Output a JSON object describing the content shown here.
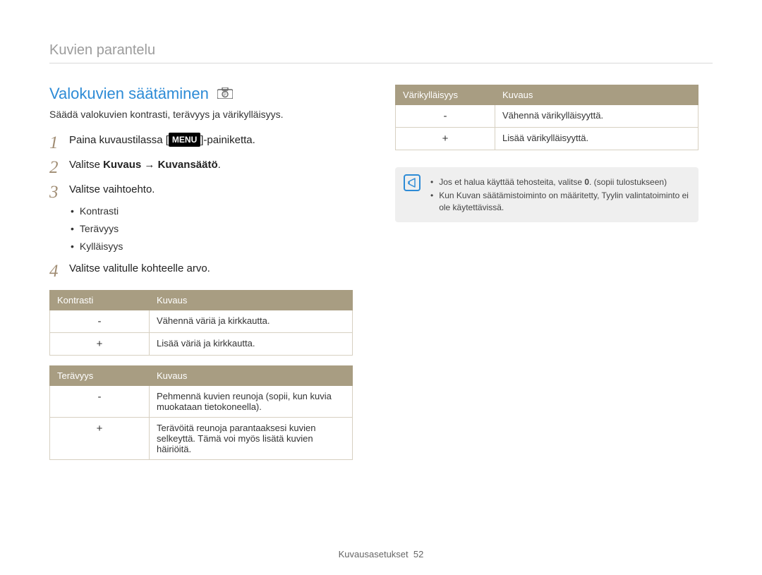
{
  "breadcrumb": "Kuvien parantelu",
  "title": "Valokuvien säätäminen",
  "intro": "Säädä valokuvien kontrasti, terävyys ja värikylläisyys.",
  "steps": {
    "s1": {
      "n": "1",
      "pre": "Paina kuvaustilassa [",
      "menu_label": "MENU",
      "post": "]-painiketta."
    },
    "s2": {
      "n": "2",
      "pre": "Valitse ",
      "bold": "Kuvaus → Kuvansäätö",
      "post": "."
    },
    "s3": {
      "n": "3",
      "text": "Valitse vaihtoehto.",
      "bullets": [
        "Kontrasti",
        "Terävyys",
        "Kylläisyys"
      ]
    },
    "s4": {
      "n": "4",
      "text": "Valitse valitulle kohteelle arvo."
    }
  },
  "tables": {
    "kontrasti": {
      "h1": "Kontrasti",
      "h2": "Kuvaus",
      "rows": [
        {
          "sign": "-",
          "desc": "Vähennä väriä ja kirkkautta."
        },
        {
          "sign": "+",
          "desc": "Lisää väriä ja kirkkautta."
        }
      ]
    },
    "teravyys": {
      "h1": "Terävyys",
      "h2": "Kuvaus",
      "rows": [
        {
          "sign": "-",
          "desc": "Pehmennä kuvien reunoja (sopii, kun kuvia muokataan tietokoneella)."
        },
        {
          "sign": "+",
          "desc": "Terävöitä reunoja parantaaksesi kuvien selkeyttä. Tämä voi myös lisätä kuvien häiriöitä."
        }
      ]
    },
    "varikyllaisyys": {
      "h1": "Värikylläisyys",
      "h2": "Kuvaus",
      "rows": [
        {
          "sign": "-",
          "desc": "Vähennä värikylläisyyttä."
        },
        {
          "sign": "+",
          "desc": "Lisää värikylläisyyttä."
        }
      ]
    }
  },
  "notes": {
    "item1": {
      "pre": "Jos et halua käyttää tehosteita, valitse ",
      "bold": "0",
      "post": ". (sopii tulostukseen)"
    },
    "item2": "Kun Kuvan säätämistoiminto on määritetty, Tyylin valintatoiminto ei ole käytettävissä."
  },
  "footer": {
    "section": "Kuvausasetukset",
    "page": "52"
  }
}
